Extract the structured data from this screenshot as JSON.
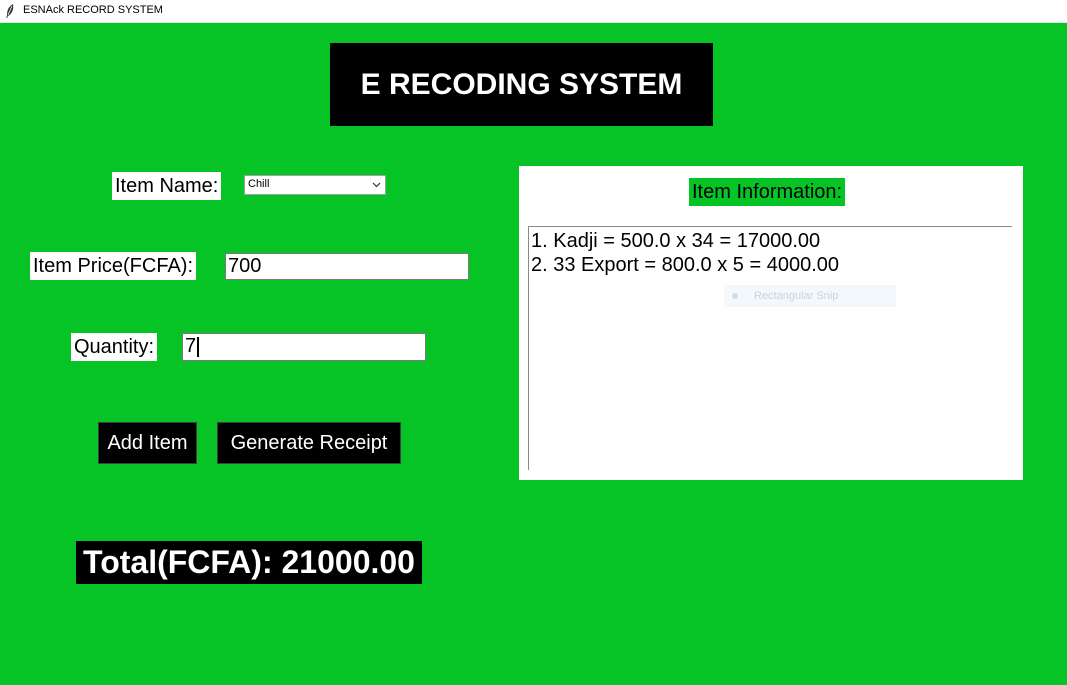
{
  "window": {
    "title": "ESNAck RECORD SYSTEM",
    "icon": "feather-icon"
  },
  "header": {
    "title": "E RECODING SYSTEM"
  },
  "form": {
    "item_name_label": "Item Name:",
    "item_name_value": "Chill",
    "item_price_label": "Item Price(FCFA):",
    "item_price_value": "700",
    "quantity_label": "Quantity:",
    "quantity_value": "7"
  },
  "buttons": {
    "add_item": "Add Item",
    "generate_receipt": "Generate Receipt"
  },
  "total": {
    "text": "Total(FCFA): 21000.00"
  },
  "info_panel": {
    "title": "Item Information:",
    "lines": [
      "1. Kadji = 500.0 x 34 = 17000.00",
      "2. 33 Export = 800.0 x 5 = 4000.00"
    ],
    "overlay_text": "Rectangular Snip"
  },
  "colors": {
    "background": "#06c426",
    "dark": "#000000",
    "light": "#ffffff"
  }
}
